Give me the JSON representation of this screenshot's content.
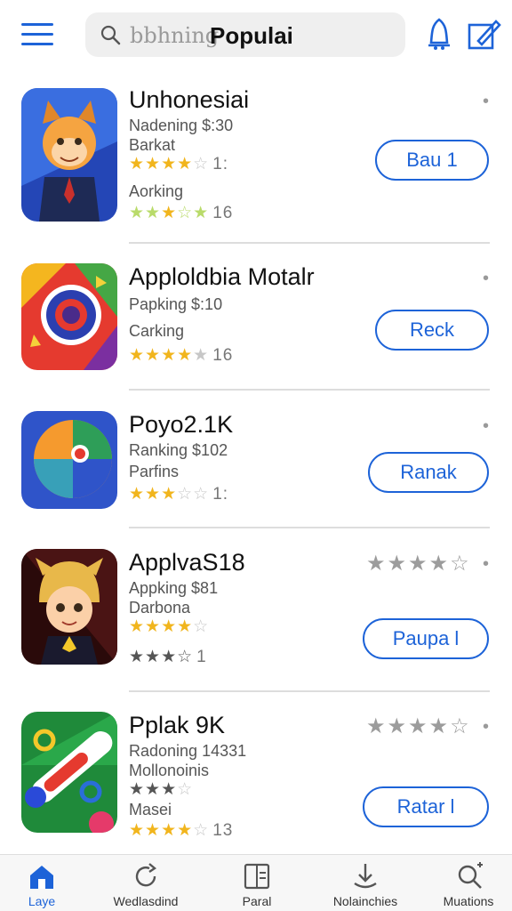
{
  "header": {
    "search_placeholder": "bbhning",
    "search_value": "Populai"
  },
  "apps": [
    {
      "title": "Unhonesiai",
      "lines": [
        "Nadening $:30",
        "Barkat"
      ],
      "stars1": {
        "filled": 4,
        "text": "1:"
      },
      "line3": "Aorking",
      "stars2": {
        "filled": 3,
        "text": "16"
      },
      "button": "Bau 1"
    },
    {
      "title": "Apploldbia Motalr",
      "lines": [
        "Papking $:10",
        "Carking"
      ],
      "stars1": {
        "filled": 4,
        "text": "16"
      },
      "button": "Reck"
    },
    {
      "title": "Poyo2.1K",
      "lines": [
        "Ranking $102",
        "Parfins"
      ],
      "stars1": {
        "filled": 3,
        "text": "1:"
      },
      "button": "Ranak"
    },
    {
      "title": "ApplvaS18",
      "lines": [
        "Appking $81",
        "Darbona"
      ],
      "stars1": {
        "filled": 4,
        "text": ""
      },
      "stars2": {
        "filled": 3,
        "text": "1"
      },
      "right_stars": "★★★★☆",
      "button": "Paupa l"
    },
    {
      "title": "Pplak 9K",
      "lines": [
        "Radoning 14331",
        "Mollonoinis"
      ],
      "stars1": {
        "filled": 3,
        "text": ""
      },
      "line3": "Masei",
      "stars2": {
        "filled": 4,
        "text": "13"
      },
      "right_stars": "★★★★☆",
      "button": "Ratar l"
    }
  ],
  "bottom_nav": [
    {
      "label": "Laye",
      "icon": "home-icon"
    },
    {
      "label": "Wedlasdind",
      "icon": "refresh-icon"
    },
    {
      "label": "Paral",
      "icon": "book-icon"
    },
    {
      "label": "Nolainchies",
      "icon": "download-icon"
    },
    {
      "label": "Muations",
      "icon": "search-plus-icon"
    }
  ],
  "colors": {
    "accent": "#1d63d8",
    "star": "#f1b51d"
  }
}
